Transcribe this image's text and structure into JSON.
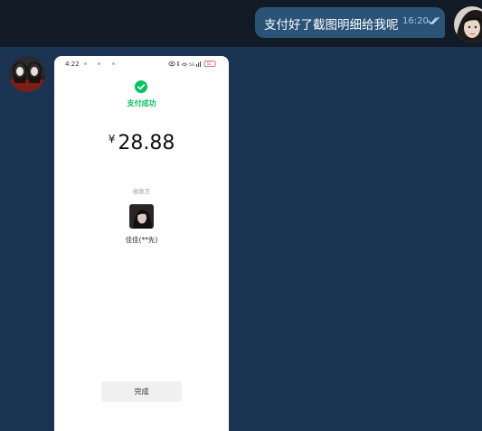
{
  "outgoing_message": {
    "text": "支付好了截图明细给我呢",
    "time": "16:20",
    "status_icon": "double-check-icon"
  },
  "shared_screenshot": {
    "status_bar": {
      "time": "4:22",
      "signal": "5G",
      "battery": "52"
    },
    "result": {
      "icon": "check-circle-icon",
      "status_text": "支付成功",
      "currency": "¥",
      "amount": "28.88"
    },
    "payee": {
      "label": "收款方",
      "name": "佳佳(**先)"
    },
    "done_button": "完成"
  },
  "colors": {
    "chat_background": "#1b3453",
    "top_band": "#121a26",
    "outgoing_bubble": "#2b5378",
    "wechat_green": "#07c160"
  }
}
